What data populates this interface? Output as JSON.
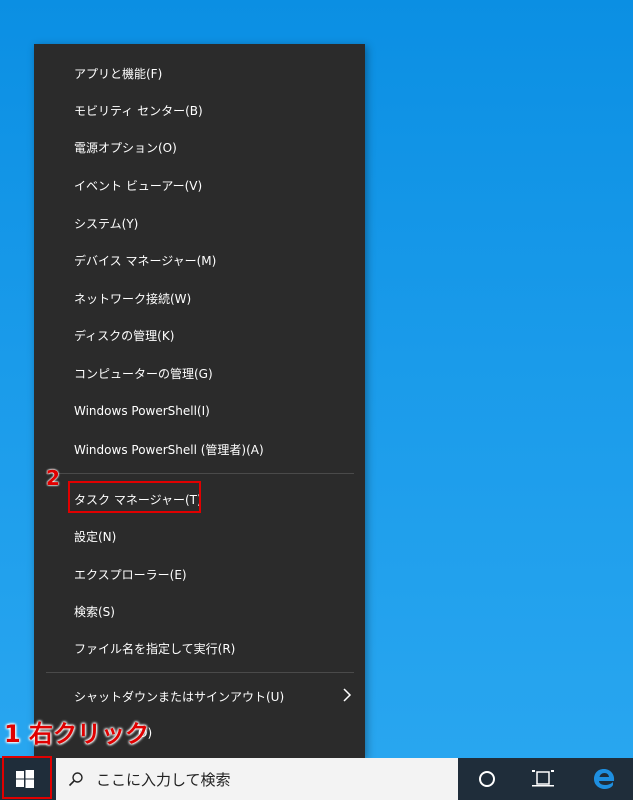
{
  "context_menu": {
    "items": [
      {
        "label": "アプリと機能(F)"
      },
      {
        "label": "モビリティ センター(B)"
      },
      {
        "label": "電源オプション(O)"
      },
      {
        "label": "イベント ビューアー(V)"
      },
      {
        "label": "システム(Y)"
      },
      {
        "label": "デバイス マネージャー(M)"
      },
      {
        "label": "ネットワーク接続(W)"
      },
      {
        "label": "ディスクの管理(K)"
      },
      {
        "label": "コンピューターの管理(G)"
      },
      {
        "label": "Windows PowerShell(I)"
      },
      {
        "label": "Windows PowerShell (管理者)(A)"
      },
      {
        "label": "タスク マネージャー(T)"
      },
      {
        "label": "設定(N)"
      },
      {
        "label": "エクスプローラー(E)"
      },
      {
        "label": "検索(S)"
      },
      {
        "label": "ファイル名を指定して実行(R)"
      },
      {
        "label": "シャットダウンまたはサインアウト(U)"
      },
      {
        "label": "O)"
      }
    ]
  },
  "annotations": {
    "step1": "1 右クリック",
    "step2": "2",
    "highlight_color": "#e00000"
  },
  "taskbar": {
    "search_placeholder": "ここに入力して検索",
    "icons": [
      "windows-logo-icon",
      "search-icon",
      "cortana-icon",
      "task-view-icon",
      "edge-icon"
    ],
    "background": "#1f2d3a"
  },
  "colors": {
    "menu_bg": "#2b2b2b",
    "menu_text": "#ffffff",
    "desktop_bg": "#1a9bea",
    "edge_blue": "#1e8fe0"
  }
}
